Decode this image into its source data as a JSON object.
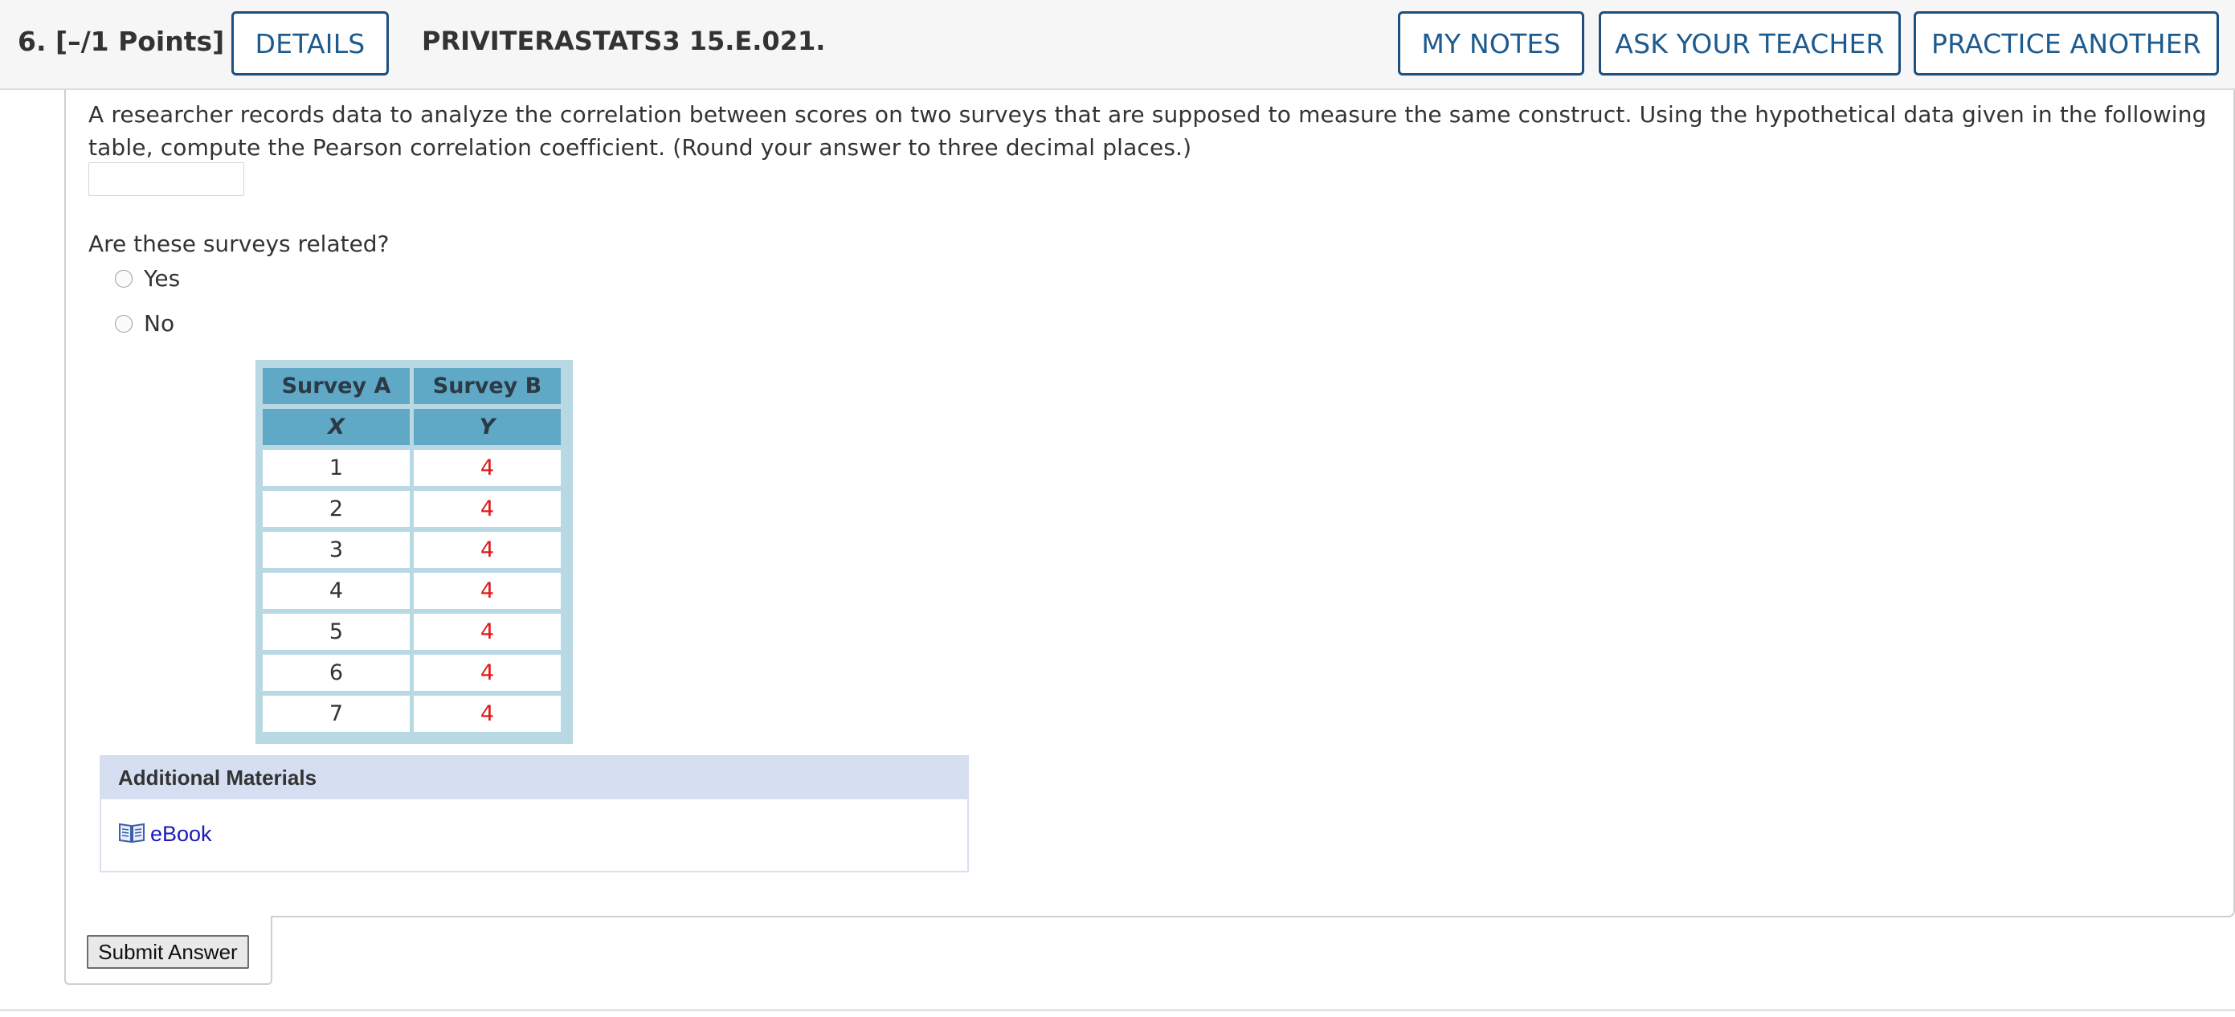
{
  "header": {
    "question_points": "6.  [–/1 Points]",
    "details_button": "DETAILS",
    "problem_code": "PRIVITERASTATS3 15.E.021.",
    "my_notes_button": "MY NOTES",
    "ask_teacher_button": "ASK YOUR TEACHER",
    "practice_button": "PRACTICE ANOTHER",
    "accent_color": "#1d4f80"
  },
  "question": {
    "prompt": "A researcher records data to analyze the correlation between scores on two surveys that are supposed to measure the same construct. Using the hypothetical data given in the following table, compute the Pearson correlation coefficient. (Round your answer to three decimal places.)",
    "answer_value": "",
    "related_question": "Are these surveys related?",
    "options": [
      "Yes",
      "No"
    ]
  },
  "table": {
    "headers": [
      "Survey A",
      "Survey B"
    ],
    "subheaders": [
      "X",
      "Y"
    ],
    "rows": [
      [
        "1",
        "4"
      ],
      [
        "2",
        "4"
      ],
      [
        "3",
        "4"
      ],
      [
        "4",
        "4"
      ],
      [
        "5",
        "4"
      ],
      [
        "6",
        "4"
      ],
      [
        "7",
        "4"
      ]
    ],
    "header_color": "#5fa8c6",
    "y_value_color": "#e0191b"
  },
  "additional_materials": {
    "title": "Additional Materials",
    "ebook_label": "eBook",
    "ebook_icon": "book-icon"
  },
  "submit": {
    "label": "Submit Answer"
  }
}
